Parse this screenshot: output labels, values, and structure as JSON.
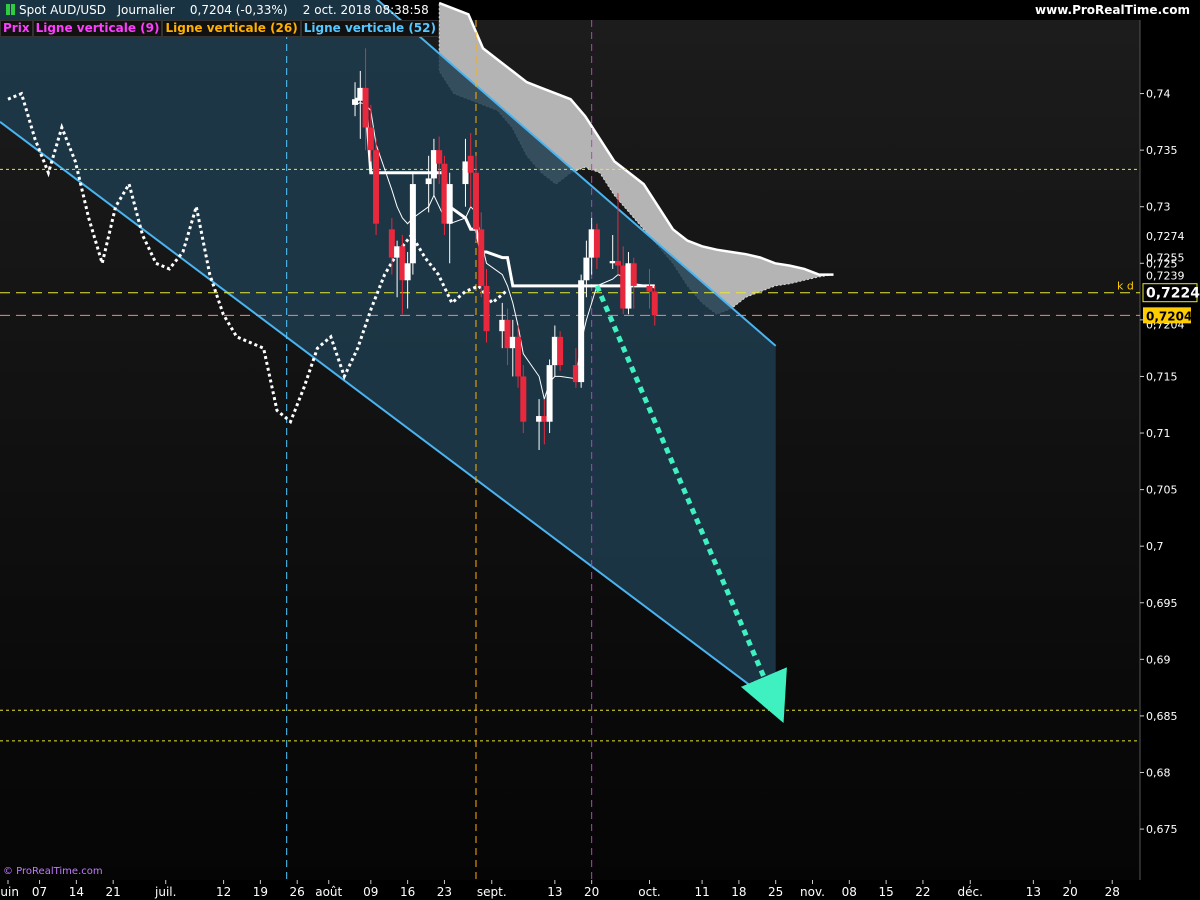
{
  "header": {
    "symbol": "Spot AUD/USD",
    "period": "Journalier",
    "quote": "0,7204 (-0,33%)",
    "datetime": "2 oct. 2018 08:38:58",
    "source": "www.ProRealTime.com"
  },
  "legend": [
    {
      "label": "Prix",
      "color": "#ff3dff"
    },
    {
      "label": "Ligne verticale (9)",
      "color": "#ff3dff"
    },
    {
      "label": "Ligne verticale (26)",
      "color": "#ffb000"
    },
    {
      "label": "Ligne verticale (52)",
      "color": "#55c8ff"
    }
  ],
  "copyright": "© ProRealTime.com",
  "colors": {
    "up_candle": "#ffffff",
    "down_candle": "#e8283c",
    "channel_line": "#4ab4f0",
    "channel_fill": "#1d3c4e",
    "cloud": "#b4b4b4",
    "arrow": "#3ff0c0",
    "price_badge": "#ffcc00"
  },
  "chart_data": {
    "type": "candlestick",
    "instrument": "AUD/USD",
    "ylim": [
      0.6705,
      0.7465
    ],
    "y_ticks": [
      "0,74",
      "0,735",
      "0,73",
      "0,725",
      "0,72",
      "0,715",
      "0,71",
      "0,705",
      "0,7",
      "0,695",
      "0,69",
      "0,685",
      "0,68",
      "0,675"
    ],
    "x_ticks": [
      "juin",
      "07",
      "14",
      "21",
      "juil.",
      "12",
      "19",
      "26",
      "août",
      "09",
      "16",
      "23",
      "sept.",
      "13",
      "20",
      "oct.",
      "11",
      "18",
      "25",
      "nov.",
      "08",
      "15",
      "22",
      "déc.",
      "13",
      "20",
      "28"
    ],
    "last_price_label": "0,7224",
    "last_price_note": "k d",
    "current_price_label": "0,7204",
    "right_price_labels": [
      "0,7274",
      "0,7255",
      "0,7239",
      "0,7204"
    ],
    "horizontal_levels": [
      {
        "value": 0.7333,
        "color": "#e8e830",
        "style": "dotted"
      },
      {
        "value": 0.7224,
        "color": "#e8e830",
        "style": "dashed"
      },
      {
        "value": 0.7204,
        "color": "#ff7f7f",
        "style": "dashed"
      },
      {
        "value": 0.6855,
        "color": "#e8e830",
        "style": "dotted"
      },
      {
        "value": 0.6828,
        "color": "#e8e830",
        "style": "dotted"
      }
    ],
    "vertical_markers": [
      {
        "date": "24 juil.",
        "color": "#55c8ff"
      },
      {
        "date": "29 août",
        "color": "#ffb000"
      },
      {
        "date": "20 sept.",
        "color": "#cc33cc"
      }
    ],
    "candles": [
      {
        "date": "2018-08-06",
        "open": 0.739,
        "high": 0.741,
        "low": 0.738,
        "close": 0.7395
      },
      {
        "date": "2018-08-07",
        "open": 0.7395,
        "high": 0.742,
        "low": 0.736,
        "close": 0.7405
      },
      {
        "date": "2018-08-08",
        "open": 0.7405,
        "high": 0.744,
        "low": 0.735,
        "close": 0.737
      },
      {
        "date": "2018-08-09",
        "open": 0.737,
        "high": 0.739,
        "low": 0.734,
        "close": 0.735
      },
      {
        "date": "2018-08-10",
        "open": 0.735,
        "high": 0.736,
        "low": 0.7275,
        "close": 0.7285
      },
      {
        "date": "2018-08-13",
        "open": 0.728,
        "high": 0.729,
        "low": 0.724,
        "close": 0.7255
      },
      {
        "date": "2018-08-14",
        "open": 0.7255,
        "high": 0.727,
        "low": 0.722,
        "close": 0.7265
      },
      {
        "date": "2018-08-15",
        "open": 0.7265,
        "high": 0.7275,
        "low": 0.7205,
        "close": 0.7235
      },
      {
        "date": "2018-08-16",
        "open": 0.7235,
        "high": 0.726,
        "low": 0.721,
        "close": 0.725
      },
      {
        "date": "2018-08-17",
        "open": 0.725,
        "high": 0.733,
        "low": 0.724,
        "close": 0.732
      },
      {
        "date": "2018-08-20",
        "open": 0.732,
        "high": 0.7345,
        "low": 0.7295,
        "close": 0.7325
      },
      {
        "date": "2018-08-21",
        "open": 0.7325,
        "high": 0.736,
        "low": 0.731,
        "close": 0.735
      },
      {
        "date": "2018-08-22",
        "open": 0.735,
        "high": 0.7362,
        "low": 0.732,
        "close": 0.7338
      },
      {
        "date": "2018-08-23",
        "open": 0.7338,
        "high": 0.7345,
        "low": 0.7275,
        "close": 0.7285
      },
      {
        "date": "2018-08-24",
        "open": 0.7285,
        "high": 0.733,
        "low": 0.725,
        "close": 0.732
      },
      {
        "date": "2018-08-27",
        "open": 0.732,
        "high": 0.736,
        "low": 0.73,
        "close": 0.734
      },
      {
        "date": "2018-08-28",
        "open": 0.7345,
        "high": 0.7365,
        "low": 0.73,
        "close": 0.733
      },
      {
        "date": "2018-08-29",
        "open": 0.733,
        "high": 0.7345,
        "low": 0.727,
        "close": 0.728
      },
      {
        "date": "2018-08-30",
        "open": 0.728,
        "high": 0.7295,
        "low": 0.722,
        "close": 0.723
      },
      {
        "date": "2018-08-31",
        "open": 0.723,
        "high": 0.7245,
        "low": 0.718,
        "close": 0.719
      },
      {
        "date": "2018-09-03",
        "open": 0.719,
        "high": 0.7215,
        "low": 0.7175,
        "close": 0.72
      },
      {
        "date": "2018-09-04",
        "open": 0.72,
        "high": 0.721,
        "low": 0.716,
        "close": 0.7175
      },
      {
        "date": "2018-09-05",
        "open": 0.7175,
        "high": 0.72,
        "low": 0.715,
        "close": 0.7185
      },
      {
        "date": "2018-09-06",
        "open": 0.7185,
        "high": 0.7195,
        "low": 0.714,
        "close": 0.715
      },
      {
        "date": "2018-09-07",
        "open": 0.715,
        "high": 0.716,
        "low": 0.71,
        "close": 0.711
      },
      {
        "date": "2018-09-10",
        "open": 0.711,
        "high": 0.713,
        "low": 0.7085,
        "close": 0.7115
      },
      {
        "date": "2018-09-11",
        "open": 0.7115,
        "high": 0.713,
        "low": 0.709,
        "close": 0.711
      },
      {
        "date": "2018-09-12",
        "open": 0.711,
        "high": 0.7165,
        "low": 0.71,
        "close": 0.716
      },
      {
        "date": "2018-09-13",
        "open": 0.716,
        "high": 0.7195,
        "low": 0.715,
        "close": 0.7185
      },
      {
        "date": "2018-09-14",
        "open": 0.7185,
        "high": 0.719,
        "low": 0.7155,
        "close": 0.716
      },
      {
        "date": "2018-09-17",
        "open": 0.716,
        "high": 0.7175,
        "low": 0.714,
        "close": 0.7145
      },
      {
        "date": "2018-09-18",
        "open": 0.7145,
        "high": 0.724,
        "low": 0.714,
        "close": 0.7235
      },
      {
        "date": "2018-09-19",
        "open": 0.7235,
        "high": 0.727,
        "low": 0.722,
        "close": 0.7255
      },
      {
        "date": "2018-09-20",
        "open": 0.7255,
        "high": 0.729,
        "low": 0.724,
        "close": 0.728
      },
      {
        "date": "2018-09-21",
        "open": 0.728,
        "high": 0.7285,
        "low": 0.7245,
        "close": 0.7255
      },
      {
        "date": "2018-09-24",
        "open": 0.725,
        "high": 0.7275,
        "low": 0.7245,
        "close": 0.7252
      },
      {
        "date": "2018-09-25",
        "open": 0.7252,
        "high": 0.7312,
        "low": 0.724,
        "close": 0.7248
      },
      {
        "date": "2018-09-26",
        "open": 0.7248,
        "high": 0.7265,
        "low": 0.7205,
        "close": 0.721
      },
      {
        "date": "2018-09-27",
        "open": 0.721,
        "high": 0.726,
        "low": 0.7205,
        "close": 0.725
      },
      {
        "date": "2018-09-28",
        "open": 0.725,
        "high": 0.7255,
        "low": 0.721,
        "close": 0.723
      },
      {
        "date": "2018-10-01",
        "open": 0.723,
        "high": 0.7245,
        "low": 0.721,
        "close": 0.7225
      },
      {
        "date": "2018-10-02",
        "open": 0.7225,
        "high": 0.723,
        "low": 0.7195,
        "close": 0.7204
      }
    ],
    "channel": {
      "upper": [
        {
          "date": "2018-08-06",
          "value": 0.75
        },
        {
          "date": "2018-10-25",
          "value": 0.7177
        }
      ],
      "lower": [
        {
          "date": "2018-06-01",
          "value": 0.7375
        },
        {
          "date": "2018-10-25",
          "value": 0.686
        }
      ]
    },
    "projection_arrow": {
      "from": {
        "date": "2018-09-21",
        "value": 0.723
      },
      "to": {
        "date": "2018-10-25",
        "value": 0.686
      }
    },
    "kijun_series": [
      0.7395,
      0.7395,
      0.7395,
      0.733,
      0.733,
      0.733,
      0.733,
      0.733,
      0.733,
      0.733,
      0.733,
      0.733,
      0.733,
      0.733,
      0.73,
      0.729,
      0.728,
      0.728,
      0.726,
      0.726,
      0.7255,
      0.7255,
      0.723,
      0.723,
      0.723,
      0.723,
      0.723,
      0.723,
      0.723,
      0.723,
      0.723,
      0.723,
      0.723,
      0.723,
      0.723,
      0.723,
      0.723,
      0.723,
      0.723,
      0.723,
      0.723,
      0.723
    ],
    "tenkan_series": [
      0.739,
      0.7392,
      0.739,
      0.7385,
      0.7355,
      0.7315,
      0.73,
      0.729,
      0.7285,
      0.729,
      0.73,
      0.731,
      0.73,
      0.729,
      0.7285,
      0.729,
      0.73,
      0.7295,
      0.727,
      0.725,
      0.724,
      0.723,
      0.7215,
      0.7195,
      0.717,
      0.715,
      0.713,
      0.7145,
      0.715,
      0.715,
      0.7148,
      0.718,
      0.72,
      0.7215,
      0.723,
      0.7236,
      0.724,
      0.7238,
      0.7235,
      0.7232,
      0.723,
      0.7228
    ],
    "chikou_series": [
      0.7395,
      0.74,
      0.736,
      0.733,
      0.737,
      0.734,
      0.729,
      0.725,
      0.73,
      0.732,
      0.7275,
      0.725,
      0.7245,
      0.726,
      0.73,
      0.724,
      0.7205,
      0.7185,
      0.718,
      0.7175,
      0.712,
      0.711,
      0.714,
      0.7175,
      0.7185,
      0.715,
      0.7175,
      0.721,
      0.724,
      0.726,
      0.7275,
      0.7255,
      0.724,
      0.7215,
      0.7225,
      0.723,
      0.7215,
      0.7225
    ],
    "cloud_span_top": [
      0.748,
      0.7475,
      0.747,
      0.744,
      0.743,
      0.742,
      0.741,
      0.7405,
      0.74,
      0.7395,
      0.738,
      0.736,
      0.734,
      0.733,
      0.732,
      0.73,
      0.728,
      0.727,
      0.7265,
      0.7262,
      0.726,
      0.7258,
      0.7255,
      0.725,
      0.7248,
      0.7245,
      0.724,
      0.724
    ],
    "cloud_span_bottom": [
      0.742,
      0.74,
      0.7395,
      0.739,
      0.7385,
      0.737,
      0.7345,
      0.733,
      0.732,
      0.733,
      0.7335,
      0.733,
      0.731,
      0.7295,
      0.728,
      0.7265,
      0.725,
      0.723,
      0.7215,
      0.7205,
      0.721,
      0.722,
      0.7225,
      0.723,
      0.7232,
      0.7235,
      0.7238,
      0.724
    ]
  }
}
